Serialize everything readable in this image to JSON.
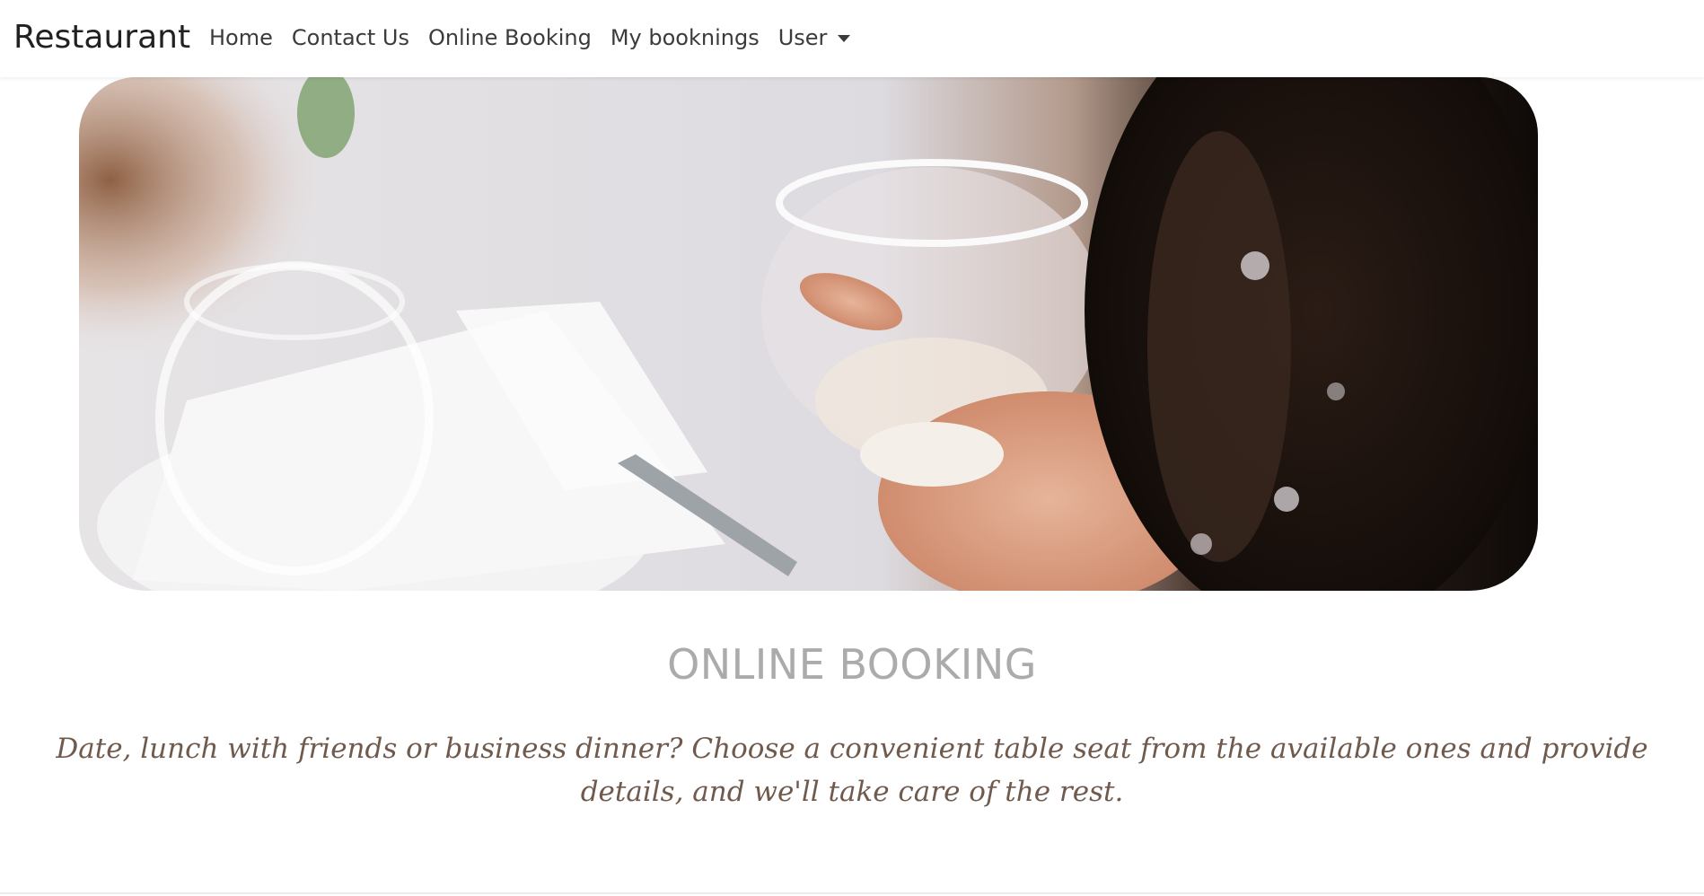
{
  "navbar": {
    "brand": "Restaurant",
    "links": [
      "Home",
      "Contact Us",
      "Online Booking",
      "My booknings"
    ],
    "user_menu": "User"
  },
  "hero": {
    "image_description": "dining-table-wine-glass-photo"
  },
  "main": {
    "title": "ONLINE BOOKING",
    "subtitle": "Date, lunch with friends or business dinner? Choose a convenient table seat from the available ones and provide details, and we'll take care of the rest."
  },
  "colors": {
    "title": "#ababab",
    "subtitle": "#6f5a4d",
    "nav_text": "#3b3b3b"
  }
}
